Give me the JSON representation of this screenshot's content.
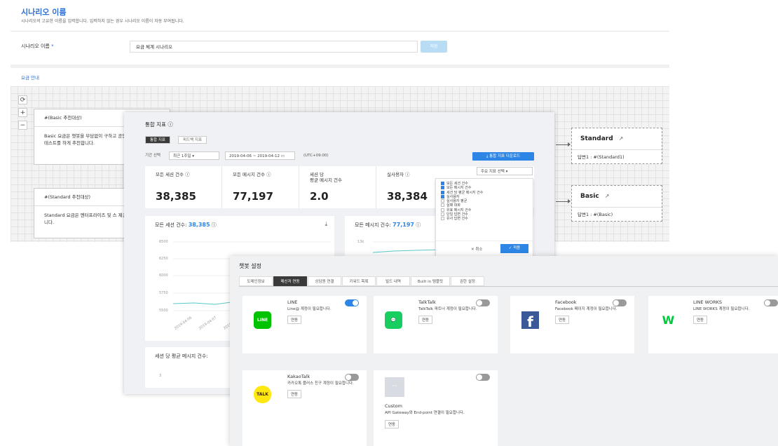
{
  "scenario": {
    "title": "시나리오 이름",
    "description": "시나리오의 고유한 이름을 입력합니다. 입력하지 않는 경우 시나리오 이름이 자동 부여됩니다.",
    "field_label": "시나리오 이름",
    "required_mark": "*",
    "input_value": "요금 체계 시나리오",
    "save_label": "저장",
    "info_link": "요금 안내",
    "controls": [
      "⟳",
      "+",
      "−"
    ],
    "nodes": [
      {
        "title": "#(Basic 추천대상)",
        "body": "Basic 요금은 챗봇을 부담없이 구하고 공인 또는 챗봇 개발 및 테스트를 하게 추천합니다."
      },
      {
        "title": "#(Standard 추천대상)",
        "body": "Standard 요금은 엔터프라이즈 및 스 제공 회사에게 추천합니다."
      }
    ],
    "targets": [
      {
        "title": "Standard",
        "answer": "답변1 : #(Standard1)"
      },
      {
        "title": "Basic",
        "answer": "답변1 : #(Basic)"
      }
    ]
  },
  "stats": {
    "title": "통합 지표",
    "tabs": [
      "통합 지표",
      "피드백 지표"
    ],
    "period_label": "기간 선택",
    "period_select": "최근 1주일",
    "date_range": "2019-04-06 ~ 2019-04-12",
    "timezone": "(UTC+09:00)",
    "download_label": "통합 지표 다운로드",
    "metric_select": "주요 지표 선택",
    "metrics": [
      {
        "label": "모든 세션 건수",
        "value": "38,385"
      },
      {
        "label": "모든 메시지 건수",
        "value": "77,197"
      },
      {
        "label": "세션 당\n평균 메시지 건수",
        "value": "2.0"
      },
      {
        "label": "실사용자",
        "value": "38,384"
      }
    ],
    "dropdown_items": [
      {
        "label": "모든 세션 건수",
        "checked": true
      },
      {
        "label": "모든 메시지 건수",
        "checked": true
      },
      {
        "label": "세션 당 평균 메시지 건수",
        "checked": true
      },
      {
        "label": "실사용자",
        "checked": true
      },
      {
        "label": "실사용자 평균",
        "checked": false
      },
      {
        "label": "실패 대화",
        "checked": false
      },
      {
        "label": "유효 메시지 건수",
        "checked": false
      },
      {
        "label": "단일 답변 건수",
        "checked": false
      },
      {
        "label": "유사 답변 건수",
        "checked": false
      }
    ],
    "cancel_label": "취소",
    "apply_label": "적용",
    "chart1": {
      "label": "모든 세션 건수:",
      "value": "38,385",
      "yticks": [
        "6500",
        "6250",
        "6000",
        "5750",
        "5500"
      ],
      "xticks": [
        "2019-04-06",
        "2019-04-07",
        "2019-04-08"
      ]
    },
    "chart2": {
      "label": "모든 메시지 건수:",
      "value": "77,197",
      "yticks": [
        "13k"
      ]
    },
    "chart3": {
      "label": "세션 당 평균 메시지 건수:",
      "yticks": [
        "3"
      ]
    }
  },
  "chatbot": {
    "title": "챗봇 설정",
    "tabs": [
      "도메인정보",
      "메신저 연동",
      "상담원 연결",
      "키워드 목록",
      "빌드 내역",
      "Built in 템플릿",
      "권한 설정"
    ],
    "active_tab": "메신저 연동",
    "cards": [
      {
        "name": "LINE",
        "desc": "Line@ 계정이 필요합니다.",
        "btn": "연동",
        "on": true,
        "icon": "line-icon",
        "color": "#00c300"
      },
      {
        "name": "TalkTalk",
        "desc": "TalkTalk 파트너 계정이 필요합니다.",
        "btn": "연동",
        "on": false,
        "icon": "talktalk-icon",
        "color": "#19ce60"
      },
      {
        "name": "Facebook",
        "desc": "Facebook 페이지 계정이 필요합니다.",
        "btn": "연동",
        "on": false,
        "icon": "facebook-icon",
        "color": "#3b5998"
      },
      {
        "name": "LINE WORKS",
        "desc": "LINE WORKS 계정이 필요합니다.",
        "btn": "연동",
        "on": false,
        "icon": "lineworks-icon",
        "color": "#00c73c"
      },
      {
        "name": "KakaoTalk",
        "desc": "카카오톡 플러스 친구 계정이 필요합니다.",
        "btn": "연동",
        "on": false,
        "icon": "kakaotalk-icon",
        "color": "#ffe812"
      },
      {
        "name": "Custom",
        "desc": "API Gateway와 End-point 연결이 필요합니다.",
        "btn": "연동",
        "on": false,
        "icon": "custom-icon",
        "color": "#d9dbe2"
      }
    ]
  }
}
